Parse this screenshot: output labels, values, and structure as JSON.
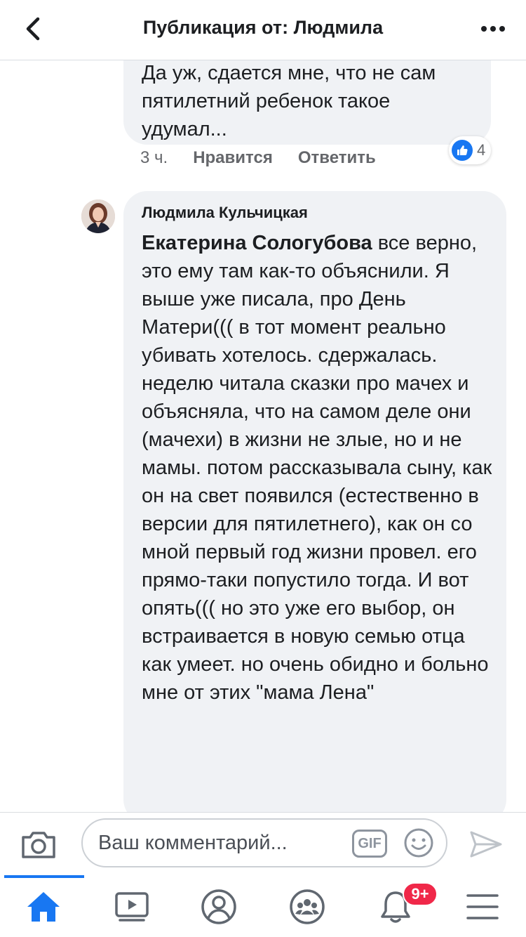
{
  "header": {
    "title": "Публикация от: Людмила",
    "back_icon": "chevron-left-icon",
    "more_icon": "more-horizontal-icon"
  },
  "previous_reply": {
    "text": "Да уж, сдается мне, что не сам\nпятилетний ребенок такое\nудумал...",
    "time": "3 ч.",
    "like_label": "Нравится",
    "reply_label": "Ответить",
    "reaction_count": "4"
  },
  "comment": {
    "author": "Людмила Кульчицкая",
    "mention": "Екатерина Сологубова",
    "text": " все верно, это ему там как-то объяснили. Я выше уже писала, про День Матери((( в тот момент реально убивать хотелось. сдержалась. неделю читала сказки про мачех и объясняла, что на самом деле они (мачехи) в жизни не злые, но и не мамы. потом рассказывала сыну, как он на свет появился (естественно в версии для пятилетнего), как он со мной первый год жизни провел. его прямо-таки попустило тогда. И вот опять((( но это уже его выбор, он встраивается в новую семью отца как умеет. но очень обидно и больно мне от этих \"мама Лена\""
  },
  "composer": {
    "placeholder": "Ваш комментарий...",
    "gif_label": "GIF"
  },
  "tabbar": {
    "notifications_badge": "9+"
  },
  "colors": {
    "accent": "#1877f2",
    "bubble": "#f0f2f5",
    "badge": "#f02849"
  }
}
